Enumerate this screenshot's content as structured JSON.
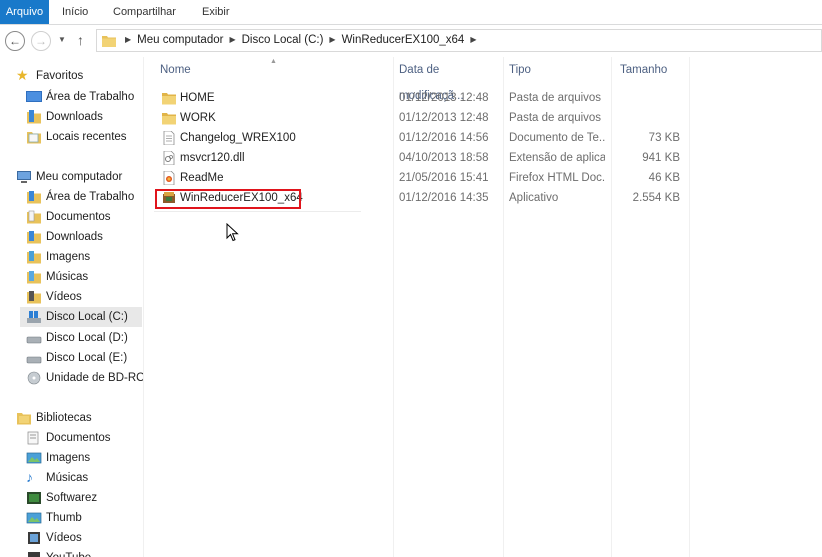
{
  "ribbon": {
    "tabs": [
      "Arquivo",
      "Início",
      "Compartilhar",
      "Exibir"
    ]
  },
  "address": {
    "crumbs": [
      "Meu computador",
      "Disco Local (C:)",
      "WinReducerEX100_x64"
    ]
  },
  "nav": {
    "favorites_label": "Favoritos",
    "favorites": [
      "Área de Trabalho",
      "Downloads",
      "Locais recentes"
    ],
    "computer_label": "Meu computador",
    "computer": [
      "Área de Trabalho",
      "Documentos",
      "Downloads",
      "Imagens",
      "Músicas",
      "Vídeos",
      "Disco Local (C:)",
      "Disco Local (D:)",
      "Disco Local (E:)",
      "Unidade de BD-ROM"
    ],
    "libraries_label": "Bibliotecas",
    "libraries": [
      "Documentos",
      "Imagens",
      "Músicas",
      "Softwarez",
      "Thumb",
      "Vídeos",
      "YouTube"
    ]
  },
  "columns": {
    "name": "Nome",
    "date": "Data de modificaçã...",
    "type": "Tipo",
    "size": "Tamanho"
  },
  "files": [
    {
      "name": "HOME",
      "date": "01/12/2013 12:48",
      "type": "Pasta de arquivos",
      "size": "",
      "icon": "folder-icon"
    },
    {
      "name": "WORK",
      "date": "01/12/2013 12:48",
      "type": "Pasta de arquivos",
      "size": "",
      "icon": "folder-icon"
    },
    {
      "name": "Changelog_WREX100",
      "date": "01/12/2016 14:56",
      "type": "Documento de Te...",
      "size": "73 KB",
      "icon": "text-document-icon"
    },
    {
      "name": "msvcr120.dll",
      "date": "04/10/2013 18:58",
      "type": "Extensão de aplica...",
      "size": "941 KB",
      "icon": "dll-file-icon"
    },
    {
      "name": "ReadMe",
      "date": "21/05/2016 15:41",
      "type": "Firefox HTML Doc...",
      "size": "46 KB",
      "icon": "html-document-icon"
    },
    {
      "name": "WinReducerEX100_x64",
      "date": "01/12/2016 14:35",
      "type": "Aplicativo",
      "size": "2.554 KB",
      "icon": "application-icon"
    }
  ],
  "colors": {
    "file_tab": "#1979ca",
    "highlight": "#e0141c",
    "folder": "#e8c25a"
  }
}
